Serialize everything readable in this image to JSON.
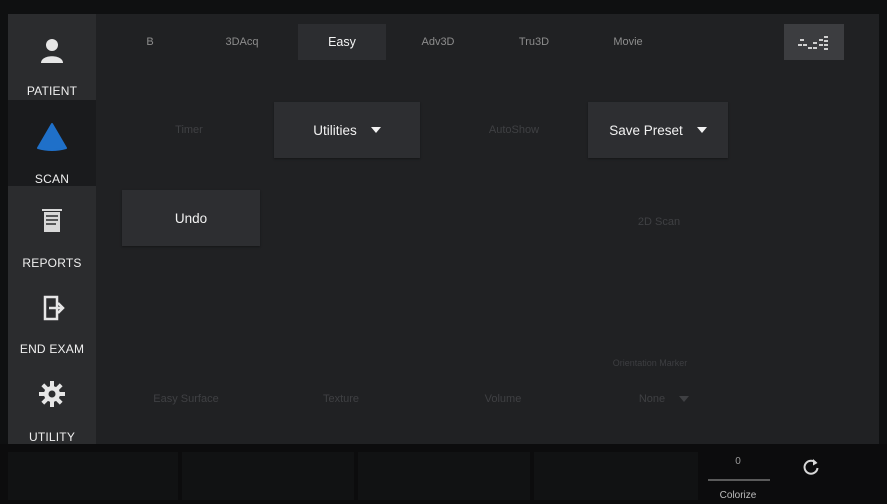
{
  "sidebar": {
    "items": [
      {
        "label": "PATIENT",
        "icon": "patient-icon"
      },
      {
        "label": "SCAN",
        "icon": "scan-icon",
        "active": true
      },
      {
        "label": "REPORTS",
        "icon": "reports-icon"
      },
      {
        "label": "END EXAM",
        "icon": "end-exam-icon"
      },
      {
        "label": "UTILITY",
        "icon": "gear-icon"
      }
    ]
  },
  "tabs": [
    {
      "label": "B"
    },
    {
      "label": "3DAcq"
    },
    {
      "label": "Easy",
      "active": true
    },
    {
      "label": "Adv3D"
    },
    {
      "label": "Tru3D"
    },
    {
      "label": "Movie"
    }
  ],
  "tab_right_icon": "bars-icon",
  "buttons": {
    "timer": "Timer",
    "utilities": "Utilities",
    "autoshow": "AutoShow",
    "save_preset": "Save Preset",
    "undo": "Undo",
    "zoom_2d": "2D Scan",
    "easy_surface": "Easy Surface",
    "texture": "Texture",
    "volume": "Volume",
    "orientation_marker_label": "Orientation Marker",
    "orientation_marker_value": "None"
  },
  "bottom": {
    "colorize_value": "0",
    "colorize_label": "Colorize",
    "colorize_level": 0
  },
  "colors": {
    "accent": "#1f70c9",
    "panel": "#202123",
    "sidebar": "#2b2c2e"
  }
}
